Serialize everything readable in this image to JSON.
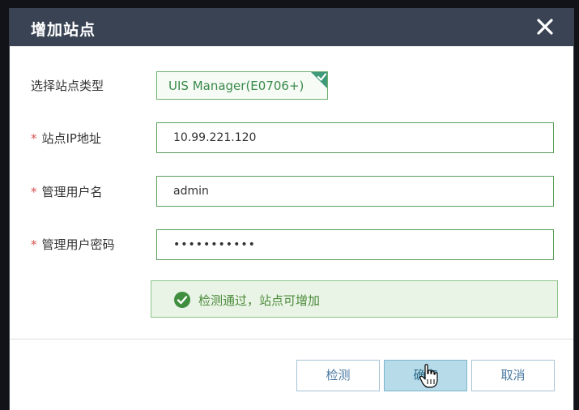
{
  "dialog": {
    "title": "增加站点",
    "close_icon": "close-icon"
  },
  "form": {
    "site_type_label": "选择站点类型",
    "site_type_value": "UIS Manager(E0706+)",
    "required_mark": "*",
    "ip_label": "站点IP地址",
    "ip_value": "10.99.221.120",
    "user_label": "管理用户名",
    "user_value": "admin",
    "password_label": "管理用户密码",
    "password_value": "•••••••••••"
  },
  "status": {
    "icon": "check-circle-icon",
    "text": "检测通过，站点可增加"
  },
  "buttons": {
    "detect": "检测",
    "confirm": "确定",
    "cancel": "取消"
  },
  "colors": {
    "titlebar": "#3a4354",
    "success_green": "#4a8a3a",
    "field_border": "#5a9e5a",
    "button_text": "#4a7aa3"
  }
}
